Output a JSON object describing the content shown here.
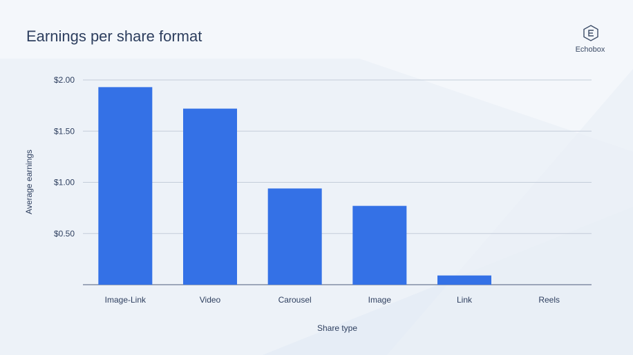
{
  "header": {
    "title": "Earnings per share format",
    "brand": "Echobox"
  },
  "colors": {
    "bar": "#3471e6",
    "grid": "#c3ccd9",
    "axis": "#4a5a7a",
    "text": "#2d3e5e"
  },
  "chart_data": {
    "type": "bar",
    "title": "Earnings per share format",
    "xlabel": "Share type",
    "ylabel": "Average earnings",
    "categories": [
      "Image-Link",
      "Video",
      "Carousel",
      "Image",
      "Link",
      "Reels"
    ],
    "values": [
      1.93,
      1.72,
      0.94,
      0.77,
      0.09,
      0
    ],
    "ylim": [
      0,
      2.0
    ],
    "yticks": [
      0.5,
      1.0,
      1.5,
      2.0
    ],
    "ytick_labels": [
      "$0.50",
      "$1.00",
      "$1.50",
      "$2.00"
    ],
    "grid": true,
    "legend": "none"
  }
}
